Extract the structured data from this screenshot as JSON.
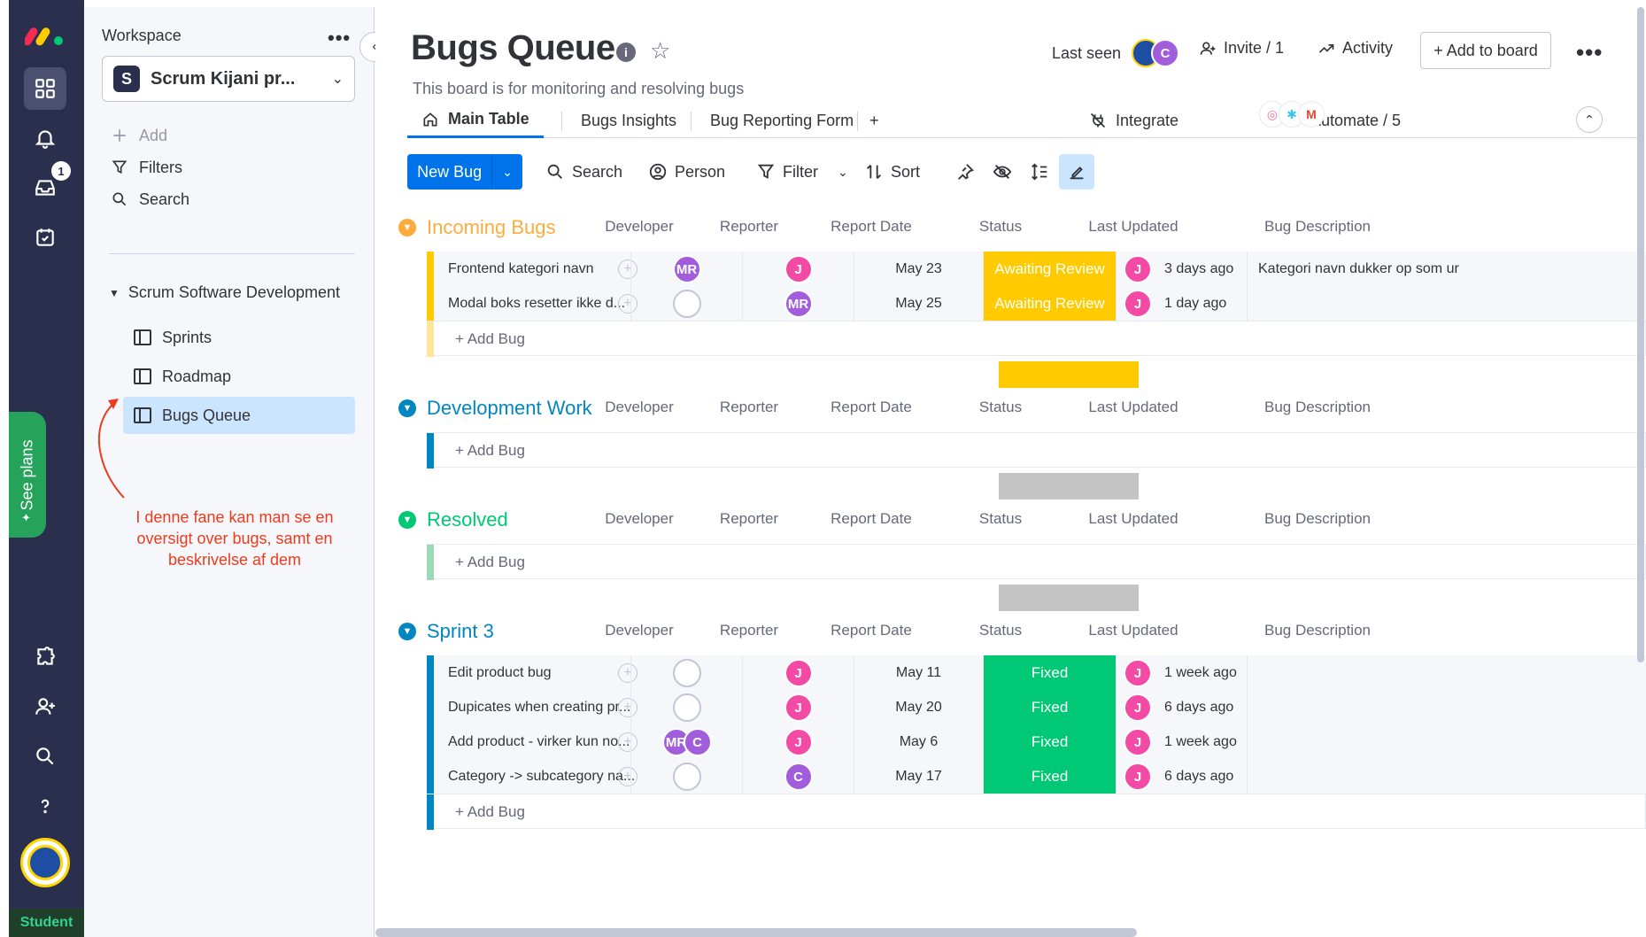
{
  "rail": {
    "inbox_badge": "1",
    "see_plans": "See plans",
    "student_label": "Student"
  },
  "sidebar": {
    "workspace_label": "Workspace",
    "workspace_more": "•••",
    "workspace_badge": "S",
    "workspace_name": "Scrum Kijani pr...",
    "add_label": "Add",
    "filters_label": "Filters",
    "search_label": "Search",
    "folder_name": "Scrum Software Development",
    "boards": [
      {
        "label": "Sprints"
      },
      {
        "label": "Roadmap"
      },
      {
        "label": "Bugs Queue"
      }
    ],
    "annotation": "I denne fane kan man se en oversigt over bugs, samt en beskrivelse af dem"
  },
  "header": {
    "title": "Bugs Queue",
    "info": "i",
    "subtitle": "This board is for monitoring and resolving bugs",
    "last_seen_label": "Last seen",
    "last_seen_avatar": "C",
    "invite_label": "Invite / 1",
    "activity_label": "Activity",
    "add_to_board_label": "+ Add to board",
    "more": "•••"
  },
  "tabs": {
    "items": [
      {
        "label": "Main Table"
      },
      {
        "label": "Bugs Insights"
      },
      {
        "label": "Bug Reporting Form"
      }
    ],
    "add": "+",
    "integrate_label": "Integrate",
    "automate_label": "Automate / 5"
  },
  "toolbar": {
    "new_label": "New Bug",
    "search_label": "Search",
    "person_label": "Person",
    "filter_label": "Filter",
    "sort_label": "Sort"
  },
  "columns": [
    "Developer",
    "Reporter",
    "Report Date",
    "Status",
    "Last Updated",
    "Bug Description"
  ],
  "groups": [
    {
      "title": "Incoming Bugs",
      "color": "#fdab3d",
      "bar_color": "#ffcb00",
      "add_label": "+ Add Bug",
      "summary_color": "#ffcb00",
      "rows": [
        {
          "name": "Frontend kategori navn",
          "developer": [
            "MR"
          ],
          "reporter": "J",
          "date": "May 23",
          "status": "Awaiting Review",
          "status_color": "#ffcb00",
          "updated_by": "J",
          "updated": "3 days ago",
          "description": "Kategori navn dukker op som ur"
        },
        {
          "name": "Modal boks resetter ikke d...",
          "developer": [],
          "reporter": "MR",
          "date": "May 25",
          "status": "Awaiting Review",
          "status_color": "#ffcb00",
          "updated_by": "J",
          "updated": "1 day ago",
          "description": ""
        }
      ]
    },
    {
      "title": "Development Work",
      "color": "#0086c0",
      "bar_color": "#0086c0",
      "add_label": "+ Add Bug",
      "summary_color": "#c4c4c4",
      "rows": []
    },
    {
      "title": "Resolved",
      "color": "#00c875",
      "bar_color": "#9cd9b7",
      "add_label": "+ Add Bug",
      "summary_color": "#c4c4c4",
      "rows": []
    },
    {
      "title": "Sprint 3",
      "color": "#0086c0",
      "bar_color": "#0086c0",
      "add_label": "+ Add Bug",
      "summary_color": "#c4c4c4",
      "rows": [
        {
          "name": "Edit product bug",
          "developer": [],
          "reporter": "J",
          "date": "May 11",
          "status": "Fixed",
          "status_color": "#00c875",
          "updated_by": "J",
          "updated": "1 week ago",
          "description": ""
        },
        {
          "name": "Dupicates when creating pr...",
          "developer": [],
          "reporter": "J",
          "date": "May 20",
          "status": "Fixed",
          "status_color": "#00c875",
          "updated_by": "J",
          "updated": "6 days ago",
          "description": ""
        },
        {
          "name": "Add product - virker kun no...",
          "developer": [
            "MR",
            "C"
          ],
          "reporter": "J",
          "date": "May 6",
          "status": "Fixed",
          "status_color": "#00c875",
          "updated_by": "J",
          "updated": "1 week ago",
          "description": ""
        },
        {
          "name": "Category -> subcategory na...",
          "developer": [],
          "reporter": "C",
          "date": "May 17",
          "status": "Fixed",
          "status_color": "#00c875",
          "updated_by": "J",
          "updated": "6 days ago",
          "description": ""
        }
      ]
    }
  ]
}
